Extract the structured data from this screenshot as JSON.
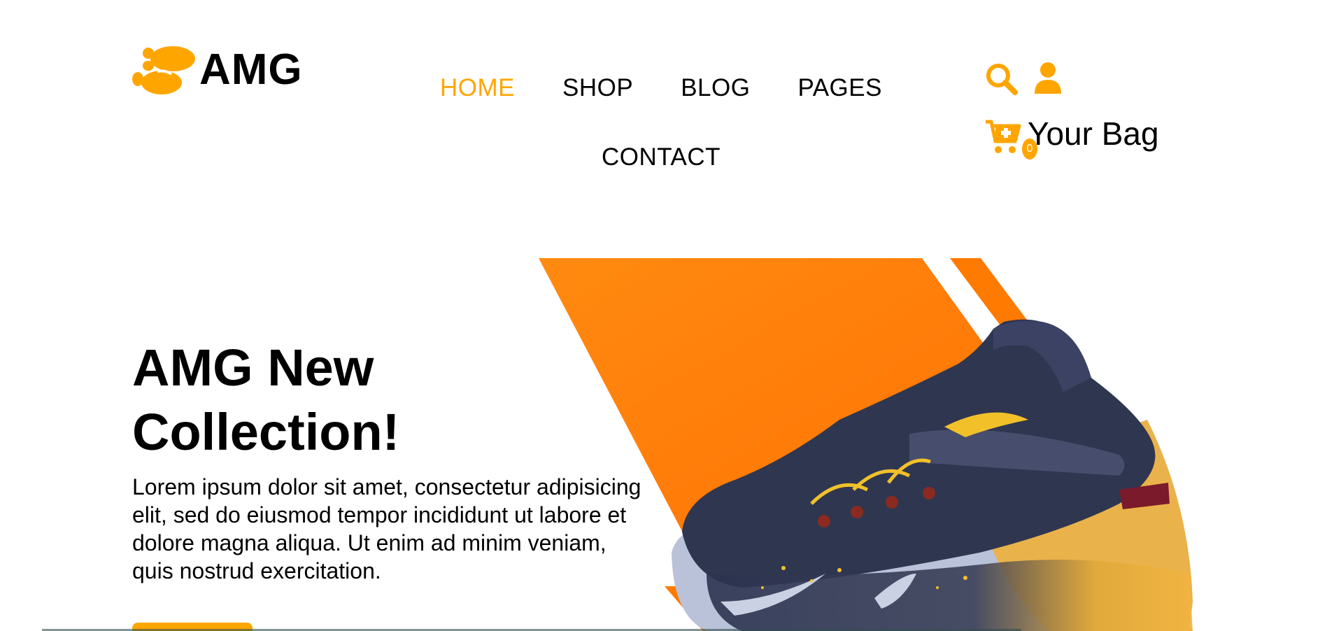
{
  "brand": {
    "name": "AMG",
    "accent_color": "#FFA500",
    "logo_icon": "footprints-icon"
  },
  "nav": {
    "items": [
      {
        "label": "HOME",
        "active": true
      },
      {
        "label": "SHOP",
        "active": false
      },
      {
        "label": "BLOG",
        "active": false
      },
      {
        "label": "PAGES",
        "active": false
      },
      {
        "label": "CONTACT",
        "active": false
      }
    ]
  },
  "header_icons": {
    "search_icon": "search-icon",
    "user_icon": "user-icon",
    "cart_icon": "cart-plus-icon",
    "cart_count": "0",
    "bag_label": "Your Bag"
  },
  "hero": {
    "title_line1": "AMG New",
    "title_line2": "Collection!",
    "text": "Lorem ipsum dolor sit amet, consectetur adipisicing elit, sed do eiusmod tempor incididunt ut labore et dolore magna aliqua. Ut enim ad minim veniam, quis nostrud exercitation.",
    "image": "sneaker-product-image",
    "background_colors": [
      "#FF7800",
      "#FF8C00"
    ]
  }
}
